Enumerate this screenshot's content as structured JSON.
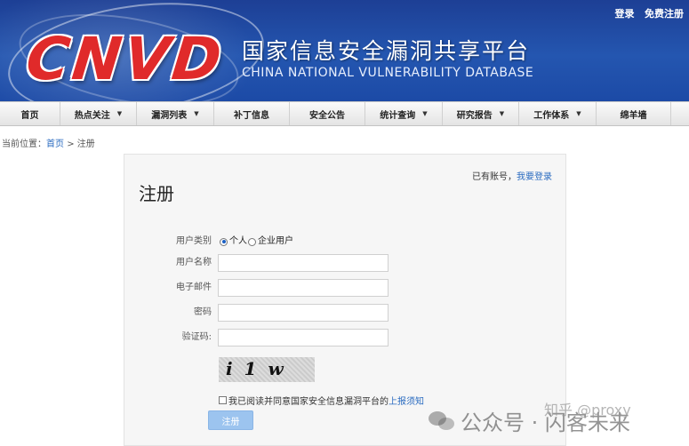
{
  "header": {
    "logo_text": "CNVD",
    "title_cn": "国家信息安全漏洞共享平台",
    "title_en": "CHINA NATIONAL VULNERABILITY DATABASE",
    "top_links": [
      "登录",
      "免费注册"
    ]
  },
  "nav": {
    "items": [
      {
        "label": "首页",
        "dropdown": false
      },
      {
        "label": "热点关注",
        "dropdown": true
      },
      {
        "label": "漏洞列表",
        "dropdown": true
      },
      {
        "label": "补丁信息",
        "dropdown": false
      },
      {
        "label": "安全公告",
        "dropdown": false
      },
      {
        "label": "统计查询",
        "dropdown": true
      },
      {
        "label": "研究报告",
        "dropdown": true
      },
      {
        "label": "工作体系",
        "dropdown": true
      },
      {
        "label": "绵羊墙",
        "dropdown": false
      }
    ],
    "caret": "▼"
  },
  "breadcrumb": {
    "prefix": "当前位置：",
    "home": "首页",
    "separator": ">",
    "current": "注册"
  },
  "form": {
    "title": "注册",
    "login_hint_text": "已有账号，",
    "login_link": "我要登录",
    "user_type_label": "用户类别",
    "user_type_options": [
      "个人",
      "企业用户"
    ],
    "user_type_selected": "个人",
    "username_label": "用户名称",
    "username_value": "",
    "email_label": "电子邮件",
    "email_value": "",
    "password_label": "密码",
    "password_value": "",
    "captcha_label": "验证码:",
    "captcha_value": "",
    "captcha_image_text": "i 1 w",
    "agree_text": "我已阅读并同意国家安全信息漏洞平台的",
    "agree_link": "上报须知",
    "agree_checked": false,
    "submit_label": "注册"
  },
  "watermark": {
    "text": "公众号 · 闪客未来",
    "zhihu": "知乎 @proxy"
  },
  "colors": {
    "header_blue": "#2456b0",
    "logo_red": "#e02a2a",
    "link_blue": "#2a6bc0",
    "button_blue": "#9cc4ef"
  }
}
